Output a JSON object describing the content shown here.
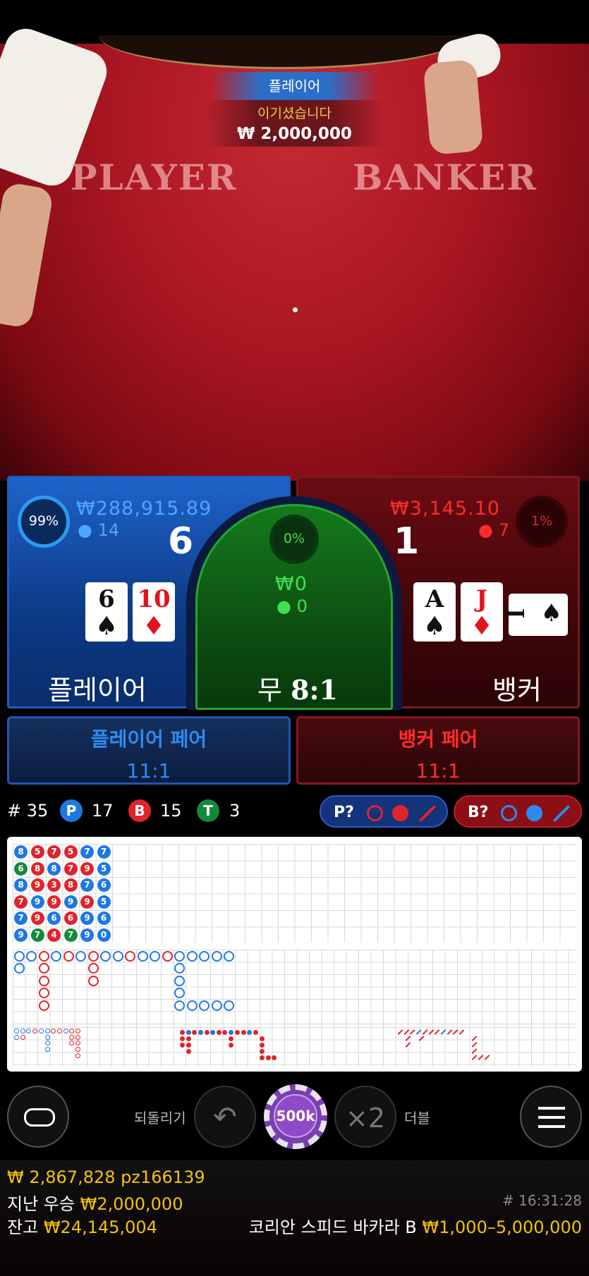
{
  "video": {
    "felt_player": "PLAYER",
    "felt_banker": "BANKER",
    "win_side": "플레이어",
    "win_label": "이기셨습니다",
    "win_amount": "₩ 2,000,000"
  },
  "player": {
    "percent": "99%",
    "stake": "₩288,915.89",
    "players": "14",
    "score": "6",
    "cards": [
      {
        "rank": "6",
        "suit": "♠",
        "color": "black"
      },
      {
        "rank": "10",
        "suit": "♦",
        "color": "red"
      }
    ],
    "label": "플레이어"
  },
  "tie": {
    "percent": "0%",
    "stake": "₩0",
    "players": "0",
    "label": "무",
    "odds": "8:1"
  },
  "banker": {
    "percent": "1%",
    "stake": "₩3,145.10",
    "players": "7",
    "score": "1",
    "cards": [
      {
        "rank": "A",
        "suit": "♠",
        "color": "black"
      },
      {
        "rank": "J",
        "suit": "♦",
        "color": "red"
      },
      {
        "rank": "J",
        "suit": "♠",
        "color": "black",
        "sideways": true
      }
    ],
    "label": "뱅커"
  },
  "pairs": {
    "player_pair_label": "플레이어 페어",
    "player_pair_odds": "11:1",
    "banker_pair_label": "뱅커 페어",
    "banker_pair_odds": "11:1"
  },
  "stats": {
    "rounds": "# 35",
    "p_letter": "P",
    "p_count": "17",
    "b_letter": "B",
    "b_count": "15",
    "t_letter": "T",
    "t_count": "3",
    "player_predict": "P?",
    "banker_predict": "B?"
  },
  "bead_road": [
    [
      {
        "v": "8",
        "c": "p"
      },
      {
        "v": "6",
        "c": "t"
      },
      {
        "v": "8",
        "c": "p"
      },
      {
        "v": "7",
        "c": "b"
      },
      {
        "v": "7",
        "c": "p"
      },
      {
        "v": "9",
        "c": "p"
      }
    ],
    [
      {
        "v": "5",
        "c": "b"
      },
      {
        "v": "8",
        "c": "b"
      },
      {
        "v": "9",
        "c": "b"
      },
      {
        "v": "9",
        "c": "p"
      },
      {
        "v": "9",
        "c": "b"
      },
      {
        "v": "7",
        "c": "t"
      }
    ],
    [
      {
        "v": "7",
        "c": "b"
      },
      {
        "v": "8",
        "c": "p"
      },
      {
        "v": "3",
        "c": "b"
      },
      {
        "v": "9",
        "c": "b"
      },
      {
        "v": "6",
        "c": "p"
      },
      {
        "v": "4",
        "c": "b"
      }
    ],
    [
      {
        "v": "5",
        "c": "b"
      },
      {
        "v": "7",
        "c": "b"
      },
      {
        "v": "8",
        "c": "b"
      },
      {
        "v": "9",
        "c": "p"
      },
      {
        "v": "6",
        "c": "b"
      },
      {
        "v": "7",
        "c": "t"
      }
    ],
    [
      {
        "v": "7",
        "c": "p"
      },
      {
        "v": "9",
        "c": "b"
      },
      {
        "v": "7",
        "c": "p"
      },
      {
        "v": "9",
        "c": "b"
      },
      {
        "v": "9",
        "c": "p"
      },
      {
        "v": "9",
        "c": "p"
      }
    ],
    [
      {
        "v": "7",
        "c": "p"
      },
      {
        "v": "5",
        "c": "p"
      },
      {
        "v": "6",
        "c": "p"
      },
      {
        "v": "5",
        "c": "p"
      },
      {
        "v": "6",
        "c": "p"
      },
      {
        "v": "0",
        "c": "p"
      }
    ]
  ],
  "controls": {
    "undo_label": "되돌리기",
    "chip_value": "500k",
    "double_symbol": "×2",
    "double_label": "더블"
  },
  "footer": {
    "last_win_amount": "₩ 2,867,828",
    "last_win_user": "pz166139",
    "last_win_label": "지난 우승",
    "last_win_value": "₩2,000,000",
    "balance_label": "잔고",
    "balance_value": "₩24,145,004",
    "round_id": "# 16:31:28",
    "table_name": "코리안 스피드 바카라 B",
    "table_limits": "₩1,000–5,000,000"
  },
  "colors": {
    "player": "#1f78e0",
    "banker": "#e0242b",
    "tie": "#138a3a",
    "gold": "#f3c20e"
  }
}
